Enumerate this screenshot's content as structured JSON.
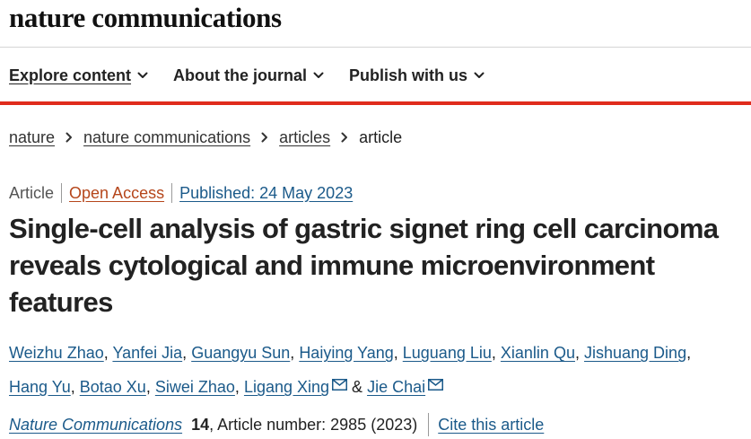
{
  "brand": {
    "name": "nature communications"
  },
  "nav": {
    "items": [
      {
        "label": "Explore content",
        "icon": "chevron-down-icon"
      },
      {
        "label": "About the journal",
        "icon": "chevron-down-icon"
      },
      {
        "label": "Publish with us",
        "icon": "chevron-down-icon"
      }
    ]
  },
  "breadcrumb": {
    "items": [
      "nature",
      "nature communications",
      "articles"
    ],
    "current": "article",
    "separator_icon": "chevron-right-icon"
  },
  "meta": {
    "type": "Article",
    "open_access": "Open Access",
    "published": "Published: 24 May 2023"
  },
  "title": "Single-cell analysis of gastric signet ring cell carcinoma reveals cytological and immune microenvironment features",
  "authors": {
    "list": [
      "Weizhu Zhao",
      "Yanfei Jia",
      "Guangyu Sun",
      "Haiying Yang",
      "Luguang Liu",
      "Xianlin Qu",
      "Jishuang Ding",
      "Hang Yu",
      "Botao Xu",
      "Siwei Zhao",
      "Ligang Xing",
      "Jie Chai"
    ],
    "separator": ",",
    "ampersand": "&",
    "mail_icon": "envelope-icon"
  },
  "citation": {
    "journal": "Nature Communications",
    "volume": "14",
    "article_number": ", Article number: 2985 (2023)",
    "cite_label": "Cite this article"
  },
  "colors": {
    "accent_red": "#e02c1c",
    "link_blue": "#1b5a8a",
    "open_access": "#b5461b",
    "text": "#222222"
  }
}
